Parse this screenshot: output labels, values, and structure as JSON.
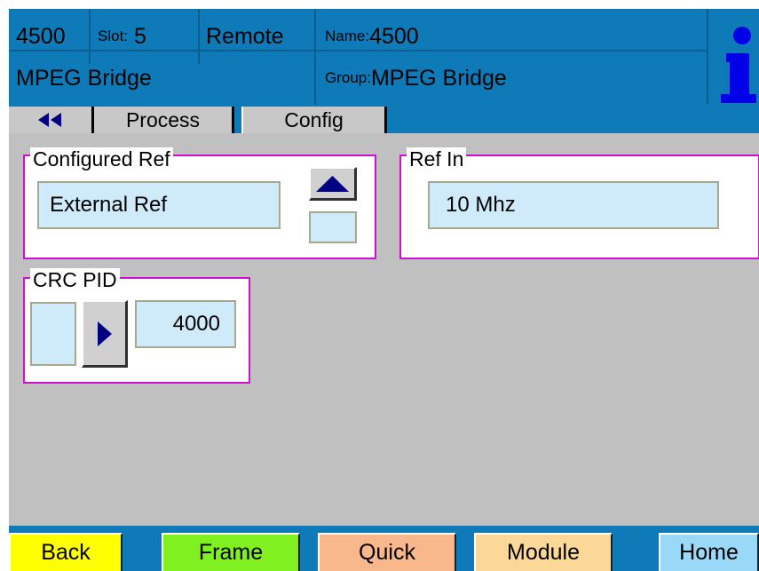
{
  "header": {
    "device": "4500",
    "slot_label": "Slot:",
    "slot_value": "5",
    "mode": "Remote",
    "name_label": "Name:",
    "name_value": "4500",
    "product": "MPEG Bridge",
    "group_label": "Group:",
    "group_value": "MPEG Bridge",
    "info_icon": "info-icon"
  },
  "tabs": {
    "back_icon": "double-left-arrow-icon",
    "items": [
      {
        "label": "Process"
      },
      {
        "label": "Config"
      }
    ]
  },
  "panels": {
    "configured_ref": {
      "label": "Configured Ref",
      "value": "External Ref",
      "up_icon": "up-arrow-icon"
    },
    "ref_in": {
      "label": "Ref In",
      "value": "10 Mhz"
    },
    "crc_pid": {
      "label": "CRC PID",
      "value": "4000",
      "arrow_icon": "right-arrow-icon"
    }
  },
  "nav": {
    "back": "Back",
    "frame": "Frame",
    "quick": "Quick",
    "module": "Module",
    "home": "Home"
  },
  "colors": {
    "header_blue": "#0e7ab8",
    "panel_border": "#d010d0",
    "field_fill": "#cfeaf8",
    "back_yellow": "#ffff00",
    "frame_green": "#80f020",
    "quick_orange": "#f8b88c",
    "module_tan": "#fcd898",
    "home_cyan": "#9ad8f8"
  }
}
